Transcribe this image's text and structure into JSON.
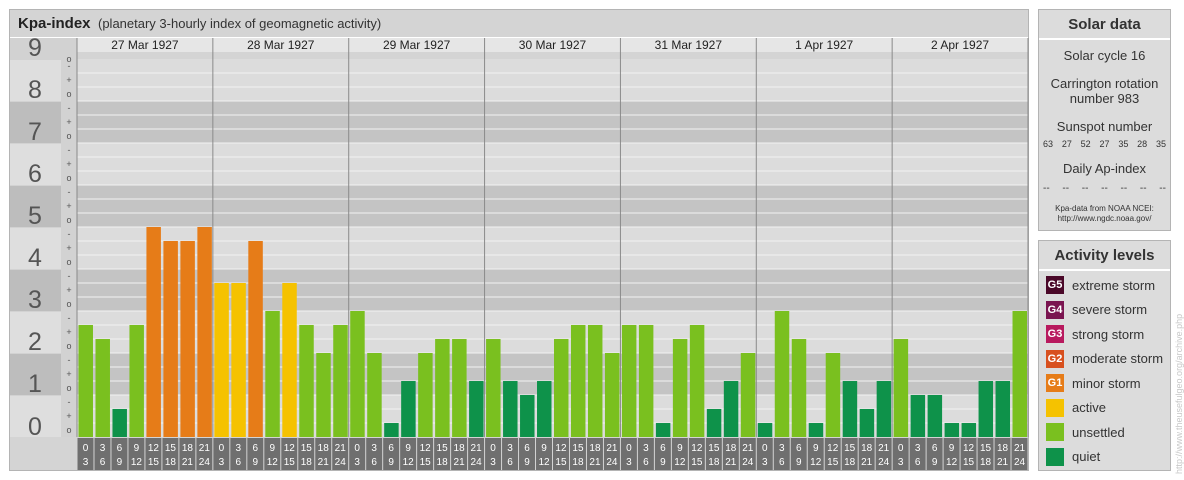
{
  "header": {
    "title": "Kpa-index",
    "subtitle": "(planetary 3-hourly index of geomagnetic activity)"
  },
  "chart_data": {
    "type": "bar",
    "y_ticks": [
      "0",
      "1",
      "2",
      "3",
      "4",
      "5",
      "6",
      "7",
      "8",
      "9"
    ],
    "y_sub_ticks": [
      "o",
      "+",
      "-"
    ],
    "ylim": [
      0,
      9
    ],
    "days": [
      {
        "date": "27 Mar 1927",
        "values": [
          2.667,
          2.333,
          0.667,
          2.667,
          5.0,
          4.667,
          4.667,
          5.0
        ]
      },
      {
        "date": "28 Mar 1927",
        "values": [
          3.667,
          3.667,
          4.667,
          3.0,
          3.667,
          2.667,
          2.0,
          2.667
        ]
      },
      {
        "date": "29 Mar 1927",
        "values": [
          3.0,
          2.0,
          0.333,
          1.333,
          2.0,
          2.333,
          2.333,
          1.333
        ]
      },
      {
        "date": "30 Mar 1927",
        "values": [
          2.333,
          1.333,
          1.0,
          1.333,
          2.333,
          2.667,
          2.667,
          2.0
        ]
      },
      {
        "date": "31 Mar 1927",
        "values": [
          2.667,
          2.667,
          0.333,
          2.333,
          2.667,
          0.667,
          1.333,
          2.0
        ]
      },
      {
        "date": "1 Apr 1927",
        "values": [
          0.333,
          3.0,
          2.333,
          0.333,
          2.0,
          1.333,
          0.667,
          1.333
        ]
      },
      {
        "date": "2 Apr 1927",
        "values": [
          2.333,
          1.0,
          1.0,
          0.333,
          0.333,
          1.333,
          1.333,
          3.0
        ]
      }
    ],
    "interval_labels": [
      [
        "0",
        "3"
      ],
      [
        "3",
        "6"
      ],
      [
        "6",
        "9"
      ],
      [
        "9",
        "12"
      ],
      [
        "12",
        "15"
      ],
      [
        "15",
        "18"
      ],
      [
        "18",
        "21"
      ],
      [
        "21",
        "24"
      ]
    ],
    "colors": {
      "quiet": "#0e924a",
      "unsettled": "#7ac01f",
      "active": "#f5c200",
      "G1": "#e67c18",
      "G2": "#d8501e",
      "G3": "#b8195e",
      "G4": "#7a1450",
      "G5": "#4a0828"
    },
    "grid": true
  },
  "solar_data": {
    "heading": "Solar data",
    "solar_cycle": "Solar cycle 16",
    "carrington_line1": "Carrington rotation",
    "carrington_line2": "number 983",
    "sunspot_label": "Sunspot number",
    "sunspot_values": [
      "63",
      "27",
      "52",
      "27",
      "35",
      "28",
      "35"
    ],
    "ap_label": "Daily Ap-index",
    "ap_values": [
      "--",
      "--",
      "--",
      "--",
      "--",
      "--",
      "--"
    ],
    "source_line1": "Kpa-data from NOAA NCEI:",
    "source_line2": "http://www.ngdc.noaa.gov/"
  },
  "activity_levels": {
    "heading": "Activity levels",
    "items": [
      {
        "badge": "G5",
        "label": "extreme storm",
        "color": "#4a0828"
      },
      {
        "badge": "G4",
        "label": "severe storm",
        "color": "#7a1450"
      },
      {
        "badge": "G3",
        "label": "strong storm",
        "color": "#b8195e"
      },
      {
        "badge": "G2",
        "label": "moderate storm",
        "color": "#d8501e"
      },
      {
        "badge": "G1",
        "label": "minor storm",
        "color": "#e67c18"
      },
      {
        "badge": "",
        "label": "active",
        "color": "#f5c200"
      },
      {
        "badge": "",
        "label": "unsettled",
        "color": "#7ac01f"
      },
      {
        "badge": "",
        "label": "quiet",
        "color": "#0e924a"
      }
    ]
  },
  "credit": "http://www.theusefulgeo.org/archive.php"
}
